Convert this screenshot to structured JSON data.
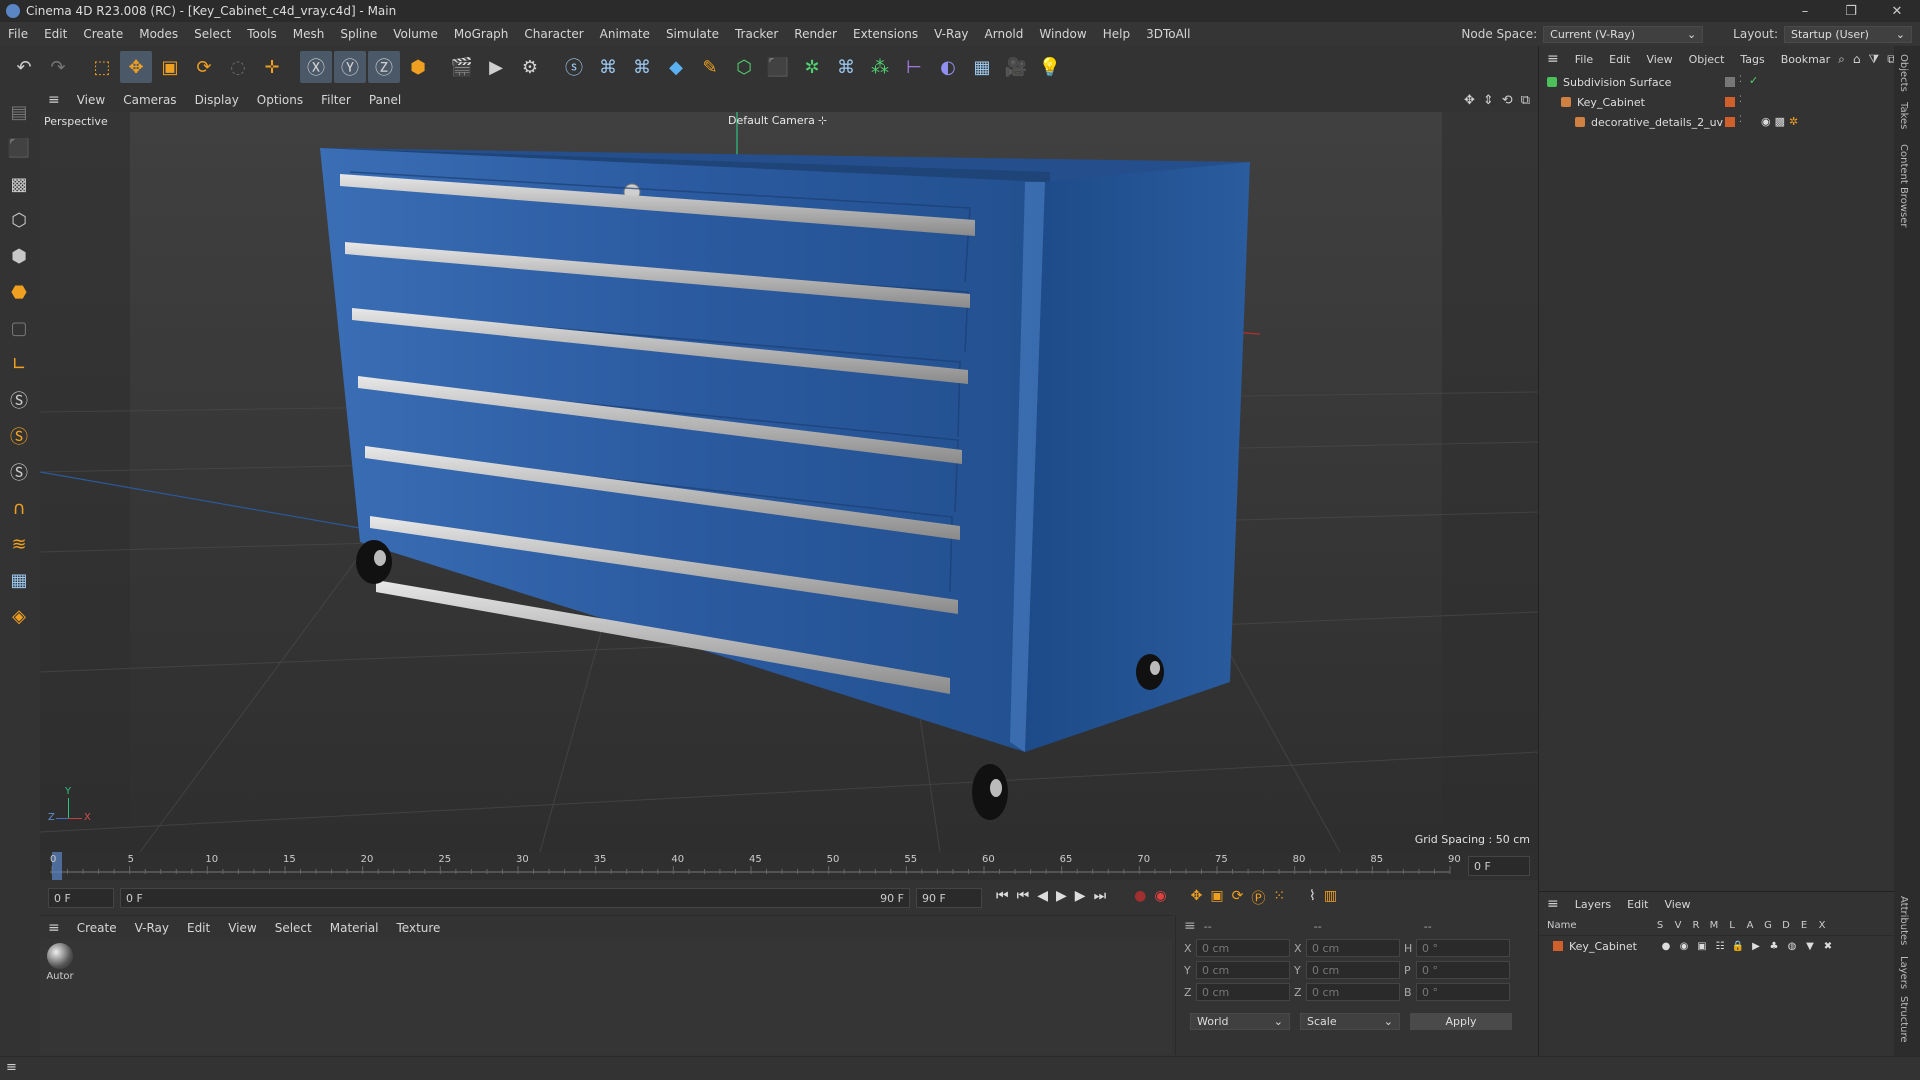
{
  "window": {
    "title": "Cinema 4D R23.008 (RC) - [Key_Cabinet_c4d_vray.c4d] - Main",
    "controls": [
      "–",
      "❐",
      "✕"
    ]
  },
  "menubar": {
    "items": [
      "File",
      "Edit",
      "Create",
      "Modes",
      "Select",
      "Tools",
      "Mesh",
      "Spline",
      "Volume",
      "MoGraph",
      "Character",
      "Animate",
      "Simulate",
      "Tracker",
      "Render",
      "Extensions",
      "V-Ray",
      "Arnold",
      "Window",
      "Help",
      "3DToAll"
    ],
    "node_space_label": "Node Space:",
    "node_space_value": "Current (V-Ray)",
    "layout_label": "Layout:",
    "layout_value": "Startup (User)"
  },
  "viewport": {
    "menu": [
      "View",
      "Cameras",
      "Display",
      "Options",
      "Filter",
      "Panel"
    ],
    "label": "Perspective",
    "camera": "Default Camera",
    "camera_icon": "⊹",
    "grid_spacing": "Grid Spacing : 50 cm",
    "axis_y": "Y",
    "axis_z": "Z",
    "axis_x": "X"
  },
  "timeline": {
    "ticks": [
      "0",
      "5",
      "10",
      "15",
      "20",
      "25",
      "30",
      "35",
      "40",
      "45",
      "50",
      "55",
      "60",
      "65",
      "70",
      "75",
      "80",
      "85",
      "90"
    ],
    "current_frame_field": "0 F"
  },
  "transport": {
    "start_field": "0 F",
    "range_start": "0 F",
    "range_end": "90 F",
    "end_field": "90 F"
  },
  "materials": {
    "menu": [
      "Create",
      "V-Ray",
      "Edit",
      "View",
      "Select",
      "Material",
      "Texture"
    ],
    "items": [
      {
        "label": "Autor"
      }
    ]
  },
  "coords": {
    "header_left": "--",
    "header_mid": "--",
    "header_right": "--",
    "rows": [
      {
        "l1": "X",
        "v1": "0 cm",
        "l2": "X",
        "v2": "0 cm",
        "l3": "H",
        "v3": "0 °"
      },
      {
        "l1": "Y",
        "v1": "0 cm",
        "l2": "Y",
        "v2": "0 cm",
        "l3": "P",
        "v3": "0 °"
      },
      {
        "l1": "Z",
        "v1": "0 cm",
        "l2": "Z",
        "v2": "0 cm",
        "l3": "B",
        "v3": "0 °"
      }
    ],
    "space_dropdown": "World",
    "mode_dropdown": "Scale",
    "apply_label": "Apply"
  },
  "objects_panel": {
    "menu": [
      "File",
      "Edit",
      "View",
      "Object",
      "Tags",
      "Bookmar"
    ],
    "rows": [
      {
        "name": "Subdivision Surface",
        "indent": 0,
        "color": "#4cc05a"
      },
      {
        "name": "Key_Cabinet",
        "indent": 1,
        "color": "#d08040"
      },
      {
        "name": "decorative_details_2_uv",
        "indent": 2,
        "color": "#d08040"
      }
    ]
  },
  "layers_panel": {
    "menu": [
      "Layers",
      "Edit",
      "View"
    ],
    "columns": [
      "Name",
      "S",
      "V",
      "R",
      "M",
      "L",
      "A",
      "G",
      "D",
      "E",
      "X"
    ],
    "rows": [
      {
        "name": "Key_Cabinet",
        "color": "#d0602a"
      }
    ]
  },
  "side_tabs": [
    "Objects",
    "Takes",
    "Content Browser",
    "Attributes",
    "Layers",
    "Structure"
  ],
  "colors": {
    "accent_blue": "#2a5c9e",
    "cabinet_blue": "#2d5fa3",
    "key_orange": "#f0a020"
  }
}
